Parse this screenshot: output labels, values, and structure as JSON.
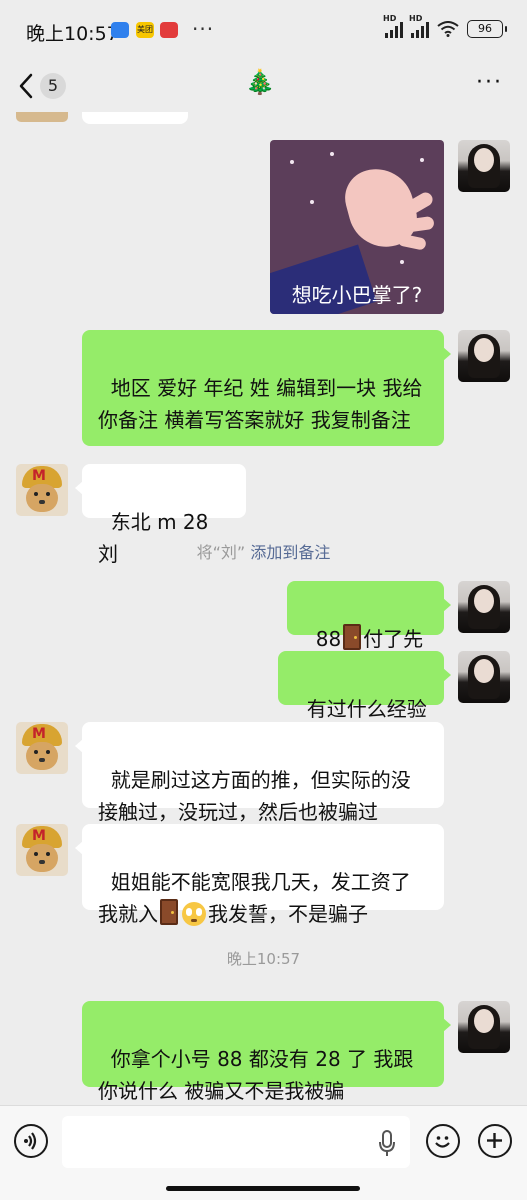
{
  "status_bar": {
    "time": "晚上10:57",
    "app_badges": [
      {
        "icon": "app-blue-icon",
        "color": "#2f80ed"
      },
      {
        "icon": "meituan-icon",
        "text": "美团",
        "color": "#f7c600"
      },
      {
        "icon": "app-red-icon",
        "color": "#e23b3b"
      }
    ],
    "more": "···",
    "signal_label_1": "HD",
    "signal_label_2": "HD",
    "battery": "96"
  },
  "nav": {
    "unread_count": "5",
    "title": "🎄",
    "menu": "···"
  },
  "chat": {
    "sticker_caption": "想吃小巴掌了?",
    "messages": [
      {
        "from": "me",
        "text": "地区 爱好 年纪 姓 编辑到一块 我给你备注 横着写答案就好 我复制备注"
      },
      {
        "from": "them",
        "text": "东北 m 28 刘"
      },
      {
        "from": "me",
        "text_before": "88",
        "text_after": "付了先",
        "emoji": "door-emoji"
      },
      {
        "from": "me",
        "text": "有过什么经验"
      },
      {
        "from": "them",
        "text": "就是刷过这方面的推，但实际的没接触过，没玩过，然后也被骗过"
      },
      {
        "from": "them",
        "text_line1": "姐姐能不能宽限我几天，发工资了",
        "text_line2_before": "我就入",
        "text_line2_after": "我发誓，不是骗子",
        "emojis": [
          "door-emoji",
          "flushed-face-emoji"
        ]
      },
      {
        "from": "me",
        "text": "你拿个小号 88 都没有 28 了 我跟你说什么 被骗又不是我被骗"
      }
    ],
    "system_note": {
      "prefix": "将“刘”",
      "link": "添加到备注"
    },
    "timestamp": "晚上10:57"
  },
  "input_bar": {
    "placeholder": "",
    "icons": [
      "voice-icon",
      "microphone-icon",
      "emoji-icon",
      "plus-icon"
    ]
  },
  "colors": {
    "bubble_out": "#95ec69",
    "bubble_in": "#ffffff",
    "background": "#ededed",
    "link": "#576b95"
  }
}
